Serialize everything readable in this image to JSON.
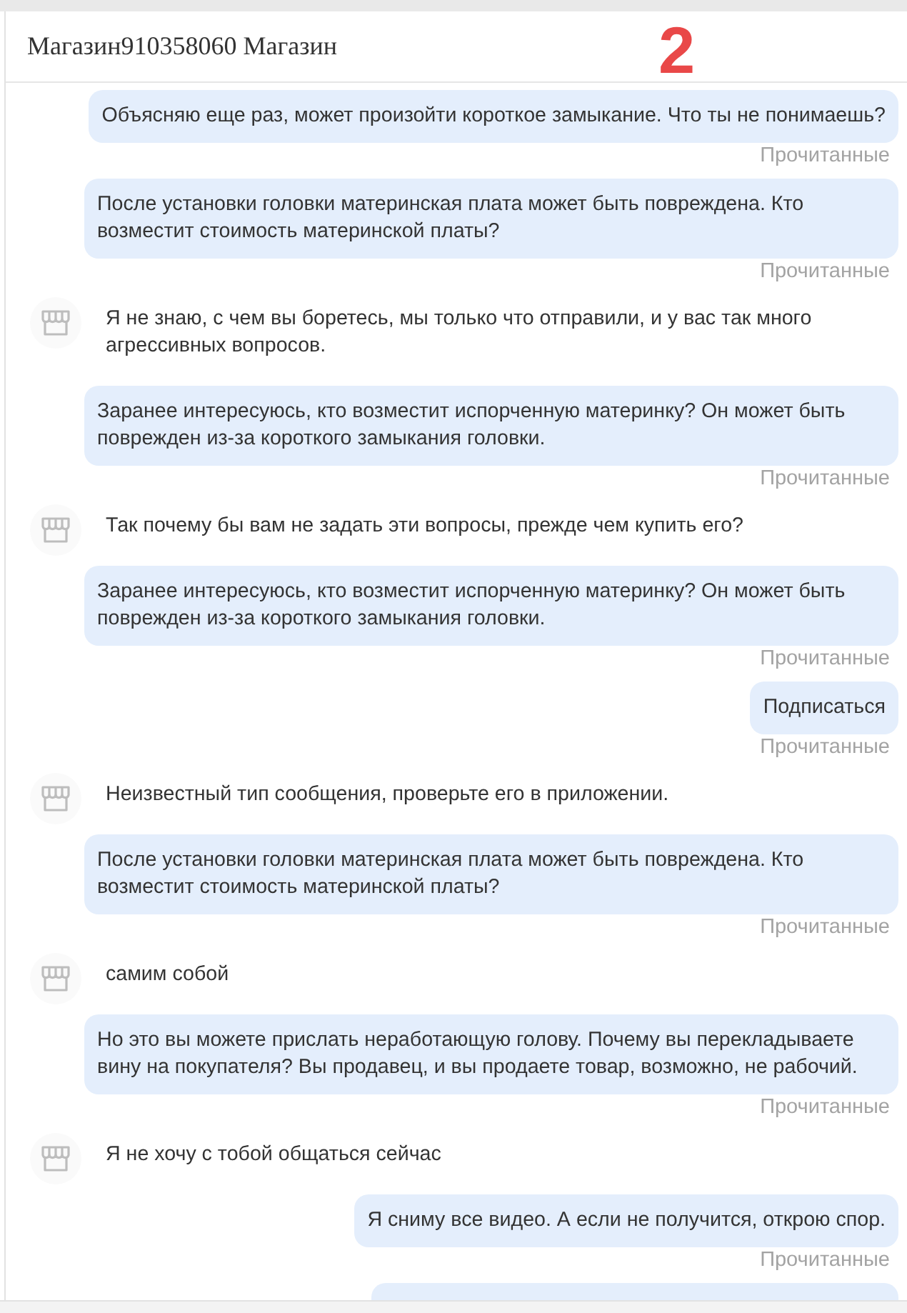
{
  "header": {
    "title": "Магазин910358060 Магазин"
  },
  "annotation": {
    "text": "2"
  },
  "messages": [
    {
      "kind": "buyer",
      "text": "Объясняю еще раз, может произойти короткое замыкание. Что ты не понимаешь?",
      "status": "Прочитанные"
    },
    {
      "kind": "buyer",
      "text": "После установки головки материнская плата может быть повреждена. Кто возместит стоимость материнской платы?",
      "status": "Прочитанные"
    },
    {
      "kind": "seller",
      "text": "Я не знаю, с чем вы боретесь, мы только что отправили, и у вас так много агрессивных вопросов."
    },
    {
      "kind": "buyer",
      "text": "Заранее интересуюсь, кто возместит испорченную материнку? Он может быть поврежден из-за короткого замыкания головки.",
      "status": "Прочитанные"
    },
    {
      "kind": "seller",
      "text": "Так почему бы вам не задать эти вопросы, прежде чем купить его?"
    },
    {
      "kind": "buyer",
      "text": "Заранее интересуюсь, кто возместит испорченную материнку? Он может быть поврежден из-за короткого замыкания головки.",
      "status": "Прочитанные"
    },
    {
      "kind": "buyer",
      "text": "Подписаться",
      "status": "Прочитанные"
    },
    {
      "kind": "seller",
      "text": "Неизвестный тип сообщения, проверьте его в приложении."
    },
    {
      "kind": "buyer",
      "text": "После установки головки материнская плата может быть повреждена. Кто возместит стоимость материнской платы?",
      "status": "Прочитанные"
    },
    {
      "kind": "seller",
      "text": "самим собой"
    },
    {
      "kind": "buyer",
      "text": "Но это вы можете прислать неработающую голову. Почему вы перекладываете вину на покупателя? Вы продавец, и вы продаете товар, возможно, не рабочий.",
      "status": "Прочитанные"
    },
    {
      "kind": "seller",
      "text": "Я не хочу с тобой общаться сейчас"
    },
    {
      "kind": "buyer",
      "text": "Я сниму все видео. А если не получится, открою спор.",
      "status": "Прочитанные"
    },
    {
      "kind": "buyer"
    }
  ]
}
